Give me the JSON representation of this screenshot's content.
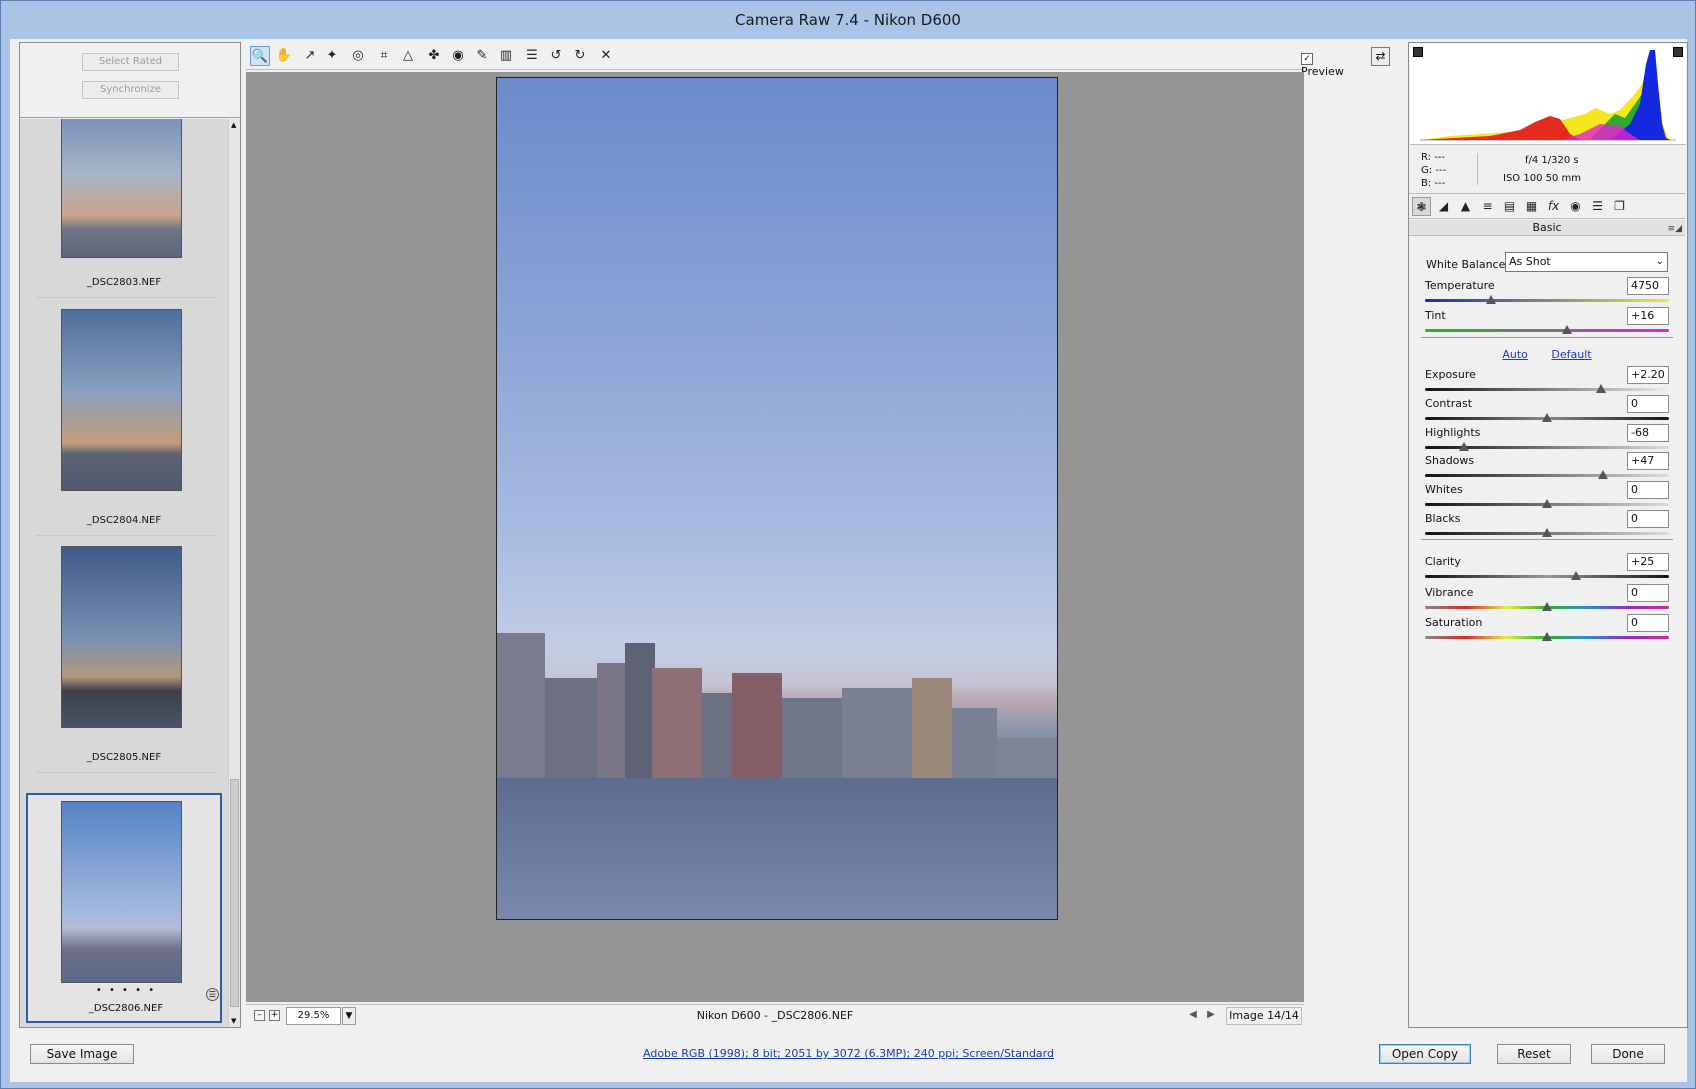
{
  "window": {
    "title": "Camera Raw 7.4  -  Nikon D600"
  },
  "filmstrip": {
    "select_rated": "Select Rated",
    "synchronize": "Synchronize",
    "items": [
      {
        "name": "_DSC2803.NEF"
      },
      {
        "name": "_DSC2804.NEF"
      },
      {
        "name": "_DSC2805.NEF"
      },
      {
        "name": "_DSC2806.NEF",
        "rating": "• • • • •",
        "selected": true
      }
    ]
  },
  "toolbar": {
    "tools": [
      {
        "name": "zoom-tool-icon",
        "glyph": "🔍"
      },
      {
        "name": "hand-tool-icon",
        "glyph": "✋"
      },
      {
        "name": "white-balance-tool-icon",
        "glyph": "↗"
      },
      {
        "name": "color-sampler-tool-icon",
        "glyph": "✦"
      },
      {
        "name": "targeted-adjustment-tool-icon",
        "glyph": "◎"
      },
      {
        "name": "crop-tool-icon",
        "glyph": "⌗"
      },
      {
        "name": "straighten-tool-icon",
        "glyph": "△"
      },
      {
        "name": "spot-removal-tool-icon",
        "glyph": "✤"
      },
      {
        "name": "red-eye-tool-icon",
        "glyph": "◉"
      },
      {
        "name": "adjustment-brush-icon",
        "glyph": "✎"
      },
      {
        "name": "graduated-filter-icon",
        "glyph": "▥"
      },
      {
        "name": "preferences-icon",
        "glyph": "☰"
      },
      {
        "name": "rotate-ccw-icon",
        "glyph": "↺"
      },
      {
        "name": "rotate-cw-icon",
        "glyph": "↻"
      },
      {
        "name": "trash-icon",
        "glyph": "✕"
      }
    ],
    "preview_label": "Preview",
    "preview_checked": "✓"
  },
  "status": {
    "zoom": "29.5%",
    "caption": "Nikon D600  -  _DSC2806.NEF",
    "image_count": "Image 14/14"
  },
  "readout": {
    "r": "R:  ---",
    "g": "G:  ---",
    "b": "B:  ---",
    "aperture_shutter": "f/4   1/320 s",
    "iso_focal": "ISO 100   50 mm"
  },
  "panel": {
    "section_title": "Basic",
    "white_balance_label": "White Balance:",
    "white_balance_value": "As Shot",
    "auto": "Auto",
    "default": "Default",
    "sliders": [
      {
        "label": "Temperature",
        "value": "4750",
        "pos": 0.27
      },
      {
        "label": "Tint",
        "value": "+16",
        "pos": 0.58
      },
      {
        "label": "Exposure",
        "value": "+2.20",
        "pos": 0.72
      },
      {
        "label": "Contrast",
        "value": "0",
        "pos": 0.5
      },
      {
        "label": "Highlights",
        "value": "-68",
        "pos": 0.16
      },
      {
        "label": "Shadows",
        "value": "+47",
        "pos": 0.73
      },
      {
        "label": "Whites",
        "value": "0",
        "pos": 0.5
      },
      {
        "label": "Blacks",
        "value": "0",
        "pos": 0.5
      },
      {
        "label": "Clarity",
        "value": "+25",
        "pos": 0.62
      },
      {
        "label": "Vibrance",
        "value": "0",
        "pos": 0.5
      },
      {
        "label": "Saturation",
        "value": "0",
        "pos": 0.5
      }
    ]
  },
  "bottom": {
    "save_image": "Save Image",
    "workflow": "Adobe RGB (1998); 8 bit; 2051 by 3072 (6.3MP); 240 ppi; Screen/Standard",
    "open_copy": "Open Copy",
    "reset": "Reset",
    "done": "Done"
  }
}
